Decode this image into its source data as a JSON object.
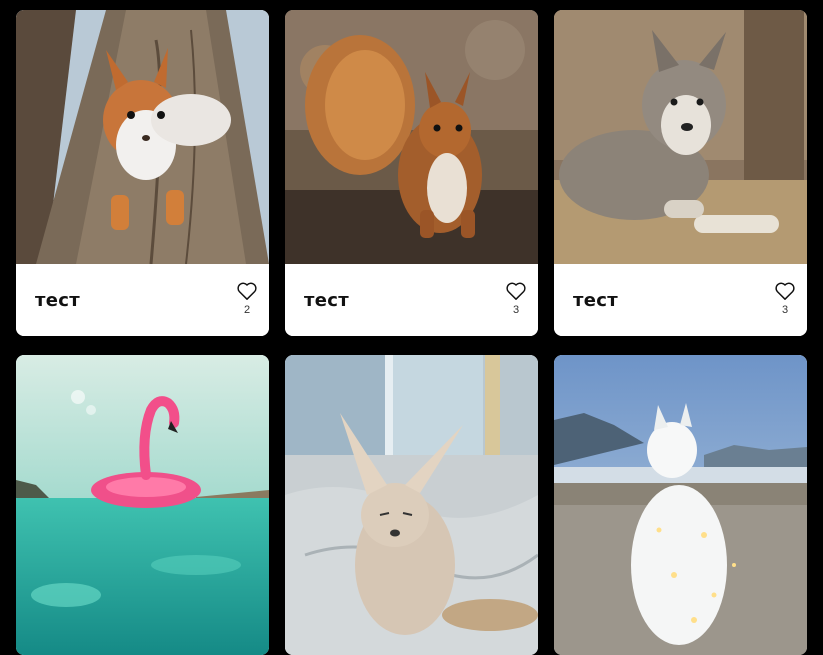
{
  "cards": [
    {
      "title": "тест",
      "likes": "2",
      "image": "squirrel-on-tree"
    },
    {
      "title": "тест",
      "likes": "3",
      "image": "squirrel-on-ground"
    },
    {
      "title": "тест",
      "likes": "3",
      "image": "wolf-lying"
    },
    {
      "image": "pink-flamingo-float"
    },
    {
      "image": "fennec-fox"
    },
    {
      "image": "white-samoyed-lights"
    }
  ],
  "icons": {
    "like": "heart-outline-icon"
  },
  "colors": {
    "background": "#000000",
    "card": "#ffffff",
    "text": "#111111"
  }
}
